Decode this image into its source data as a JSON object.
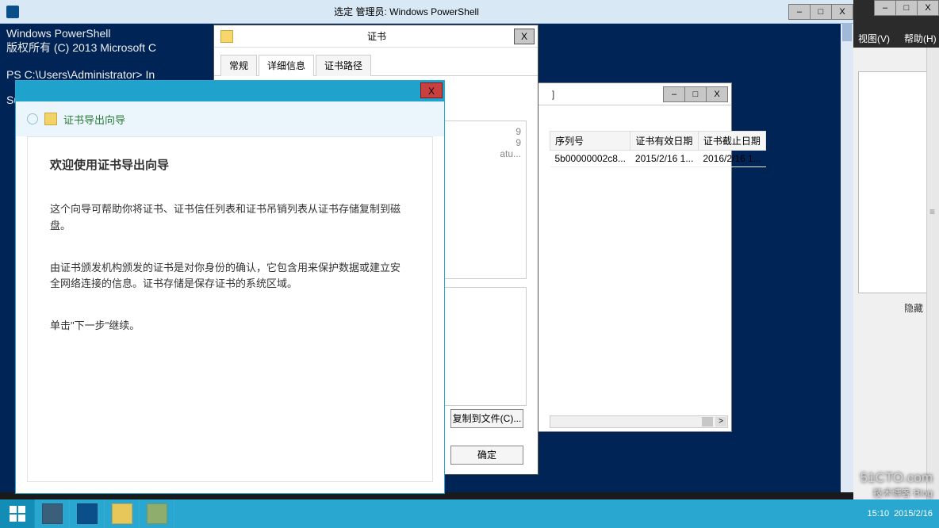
{
  "topmenu": {
    "view": "视图(V)",
    "help": "帮助(H)"
  },
  "rightpane": {
    "hide": "隐藏"
  },
  "powershell": {
    "title": "选定 管理员: Windows PowerShell",
    "lines": {
      "l1": "Windows PowerShell",
      "l2": "版权所有 (C) 2013 Microsoft C",
      "l3": "",
      "l4": "PS C:\\Users\\Administrator> In                                              p-enrollment -IncludeManagementTools",
      "l5": "",
      "l6": "Success Res"
    }
  },
  "mmc": {
    "title_frag": "]",
    "headers": {
      "serial": "序列号",
      "valid": "证书有效日期",
      "expire": "证书截止日期"
    },
    "row": {
      "serialpfx": "5b00000002c8...",
      "valid": "2015/2/16 1...",
      "expire": "2016/2/16 1..."
    },
    "frag1": "9",
    "frag2": "9",
    "frag3": "atu..."
  },
  "cert": {
    "title": "证书",
    "tabs": {
      "general": "常规",
      "details": "详细信息",
      "path": "证书路径"
    },
    "btn_copy": "复制到文件(C)...",
    "btn_ok": "确定"
  },
  "wizard": {
    "head": "证书导出向导",
    "h3": "欢迎使用证书导出向导",
    "p1": "这个向导可帮助你将证书、证书信任列表和证书吊销列表从证书存储复制到磁盘。",
    "p2": "由证书颁发机构颁发的证书是对你身份的确认，它包含用来保护数据或建立安全网络连接的信息。证书存储是保存证书的系统区域。",
    "p3": "单击\"下一步\"继续。"
  },
  "watermark": {
    "l1": "51CTO.com",
    "l2": "技术博客  Blog"
  },
  "taskbar": {
    "time": "15:10",
    "date": "2015/2/16"
  },
  "glyph": {
    "min": "–",
    "max": "□",
    "close": "X",
    "right": ">"
  }
}
